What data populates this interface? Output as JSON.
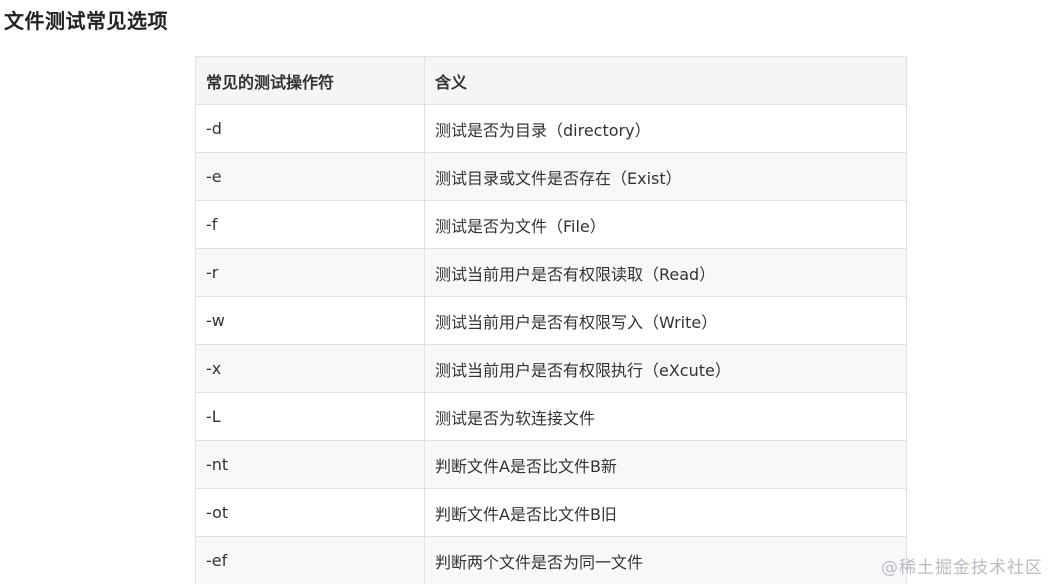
{
  "heading": "文件测试常见选项",
  "table": {
    "headers": [
      "常见的测试操作符",
      "含义"
    ],
    "rows": [
      [
        "-d",
        "测试是否为目录（directory）"
      ],
      [
        "-e",
        "测试目录或文件是否存在（Exist）"
      ],
      [
        "-f",
        "测试是否为文件（File）"
      ],
      [
        "-r",
        "测试当前用户是否有权限读取（Read）"
      ],
      [
        "-w",
        "测试当前用户是否有权限写入（Write）"
      ],
      [
        "-x",
        "测试当前用户是否有权限执行（eXcute）"
      ],
      [
        "-L",
        "测试是否为软连接文件"
      ],
      [
        "-nt",
        "判断文件A是否比文件B新"
      ],
      [
        "-ot",
        "判断文件A是否比文件B旧"
      ],
      [
        "-ef",
        "判断两个文件是否为同一文件"
      ]
    ]
  },
  "watermark": "@稀土掘金技术社区"
}
